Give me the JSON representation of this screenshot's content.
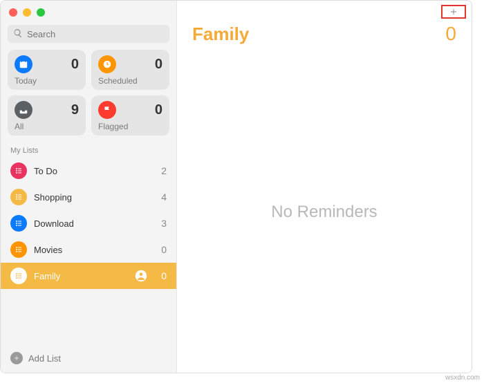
{
  "search": {
    "placeholder": "Search"
  },
  "smart_cards": {
    "today": {
      "label": "Today",
      "count": "0",
      "color": "#0a7aff"
    },
    "scheduled": {
      "label": "Scheduled",
      "count": "0",
      "color": "#ff9500"
    },
    "all": {
      "label": "All",
      "count": "9",
      "color": "#5b6065"
    },
    "flagged": {
      "label": "Flagged",
      "count": "0",
      "color": "#ff3b30"
    }
  },
  "my_lists_label": "My Lists",
  "lists": [
    {
      "name": "To Do",
      "count": "2",
      "color": "#e8345f"
    },
    {
      "name": "Shopping",
      "count": "4",
      "color": "#f5b946"
    },
    {
      "name": "Download",
      "count": "3",
      "color": "#0a7aff"
    },
    {
      "name": "Movies",
      "count": "0",
      "color": "#ff9500"
    },
    {
      "name": "Family",
      "count": "0",
      "color": "#f5b946",
      "shared": true,
      "selected": true
    }
  ],
  "footer": {
    "add_list_label": "Add List"
  },
  "main": {
    "title": "Family",
    "count": "0",
    "accent": "#f5a937",
    "empty_text": "No Reminders"
  },
  "watermark": "wsxdn.com"
}
